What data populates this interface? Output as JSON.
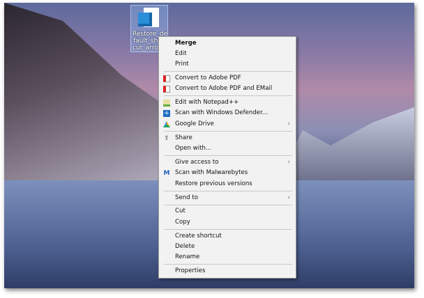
{
  "desktop": {
    "file_icon": {
      "label": "Restore_default_shortcut_arrow.reg"
    }
  },
  "menu": {
    "items": [
      {
        "label": "Merge",
        "bold": true
      },
      {
        "label": "Edit"
      },
      {
        "label": "Print"
      },
      {
        "label": "Convert to Adobe PDF",
        "icon": "adobe-pdf-icon"
      },
      {
        "label": "Convert to Adobe PDF and EMail",
        "icon": "adobe-pdf-email-icon"
      },
      {
        "label": "Edit with Notepad++",
        "icon": "notepad-plus-plus-icon"
      },
      {
        "label": "Scan with Windows Defender...",
        "icon": "windows-defender-icon"
      },
      {
        "label": "Google Drive",
        "icon": "google-drive-icon",
        "submenu": true
      },
      {
        "label": "Share",
        "icon": "share-icon"
      },
      {
        "label": "Open with..."
      },
      {
        "label": "Give access to",
        "submenu": true
      },
      {
        "label": "Scan with Malwarebytes",
        "icon": "malwarebytes-icon"
      },
      {
        "label": "Restore previous versions"
      },
      {
        "label": "Send to",
        "submenu": true
      },
      {
        "label": "Cut"
      },
      {
        "label": "Copy"
      },
      {
        "label": "Create shortcut"
      },
      {
        "label": "Delete"
      },
      {
        "label": "Rename"
      },
      {
        "label": "Properties"
      }
    ],
    "submenu_arrow": "›"
  }
}
